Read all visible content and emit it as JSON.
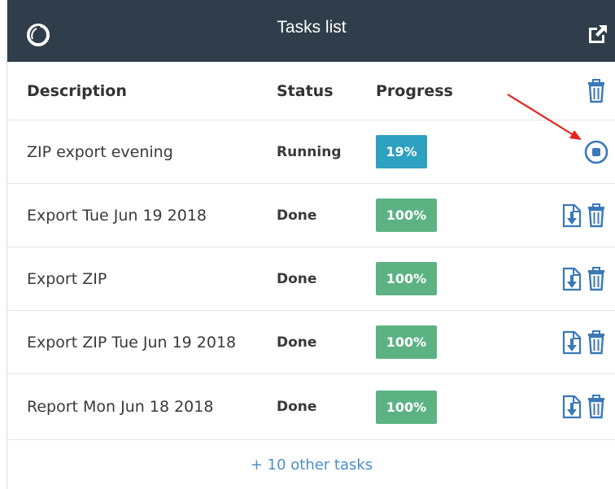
{
  "window": {
    "title": "Tasks list",
    "logo_icon": "circle-logo-icon",
    "popout_icon": "external-link-icon"
  },
  "table": {
    "headers": {
      "description": "Description",
      "status": "Status",
      "progress": "Progress"
    },
    "header_action_icon": "trash-icon",
    "rows": [
      {
        "description": "ZIP export evening",
        "status": "Running",
        "progress": "19%",
        "progress_value": 0.19,
        "actions": [
          "stop-icon"
        ]
      },
      {
        "description": "Export Tue Jun 19 2018",
        "status": "Done",
        "progress": "100%",
        "progress_value": 1.0,
        "actions": [
          "download-icon",
          "trash-icon"
        ]
      },
      {
        "description": "Export ZIP",
        "status": "Done",
        "progress": "100%",
        "progress_value": 1.0,
        "actions": [
          "download-icon",
          "trash-icon"
        ]
      },
      {
        "description": "Export ZIP Tue Jun 19 2018",
        "status": "Done",
        "progress": "100%",
        "progress_value": 1.0,
        "actions": [
          "download-icon",
          "trash-icon"
        ]
      },
      {
        "description": "Report Mon Jun 18 2018",
        "status": "Done",
        "progress": "100%",
        "progress_value": 1.0,
        "actions": [
          "download-icon",
          "trash-icon"
        ]
      }
    ]
  },
  "footer": {
    "more_tasks": "+ 10 other tasks"
  },
  "colors": {
    "titlebar": "#2f3e4a",
    "running": "#2ea0c0",
    "done": "#5cb283",
    "icon": "#3a78b8",
    "link": "#4a90c8",
    "annotation_arrow": "#e8201c"
  }
}
